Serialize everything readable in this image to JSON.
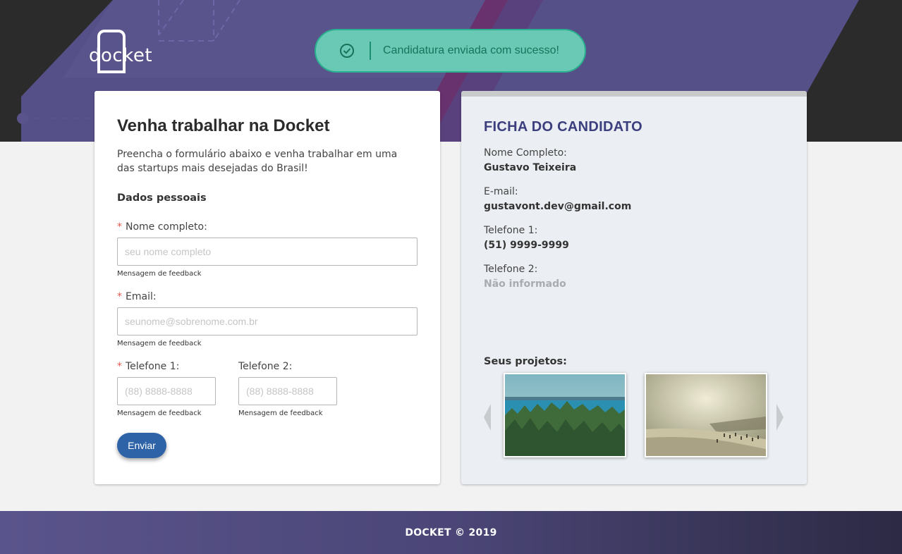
{
  "brand": {
    "logo_text": "docket"
  },
  "toast": {
    "message": "Candidatura enviada com sucesso!"
  },
  "form": {
    "title": "Venha trabalhar na Docket",
    "intro": "Preencha o formulário abaixo e venha trabalhar em uma das startups mais desejadas do Brasil!",
    "section_title": "Dados pessoais",
    "fields": {
      "nome": {
        "label": "Nome completo:",
        "required": "*",
        "placeholder": "seu nome completo",
        "feedback": "Mensagem de feedback"
      },
      "email": {
        "label": "Email:",
        "required": "*",
        "placeholder": "seunome@sobrenome.com.br",
        "feedback": "Mensagem de feedback"
      },
      "telefone1": {
        "label": "Telefone 1:",
        "required": "*",
        "placeholder": "(88) 8888-8888",
        "feedback": "Mensagem de feedback"
      },
      "telefone2": {
        "label": "Telefone 2:",
        "placeholder": "(88) 8888-8888",
        "feedback": "Mensagem de feedback"
      }
    },
    "submit_label": "Enviar"
  },
  "ficha": {
    "title": "FICHA DO CANDIDATO",
    "nome": {
      "label": "Nome Completo:",
      "value": "Gustavo Teixeira"
    },
    "email": {
      "label": "E-mail:",
      "value": "gustavont.dev@gmail.com"
    },
    "telefone1": {
      "label": "Telefone 1:",
      "value": "(51) 9999-9999"
    },
    "telefone2": {
      "label": "Telefone 2:",
      "value": "Não informado"
    },
    "projects_title": "Seus projetos:"
  },
  "footer": {
    "text": "DOCKET © 2019"
  },
  "colors": {
    "accent_purple": "#5a548c",
    "header_dark": "#2c2b2b",
    "toast_green": "#6ac9b5",
    "button_blue": "#2e63a8",
    "ficha_title": "#3c3f7d"
  }
}
